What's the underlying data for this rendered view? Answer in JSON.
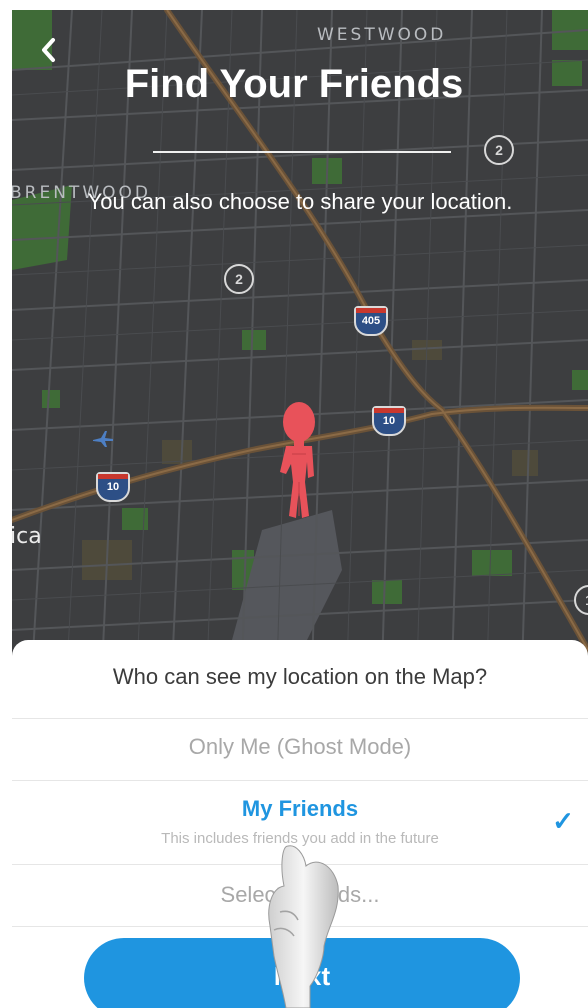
{
  "header": {
    "back_icon": "chevron-left-icon",
    "back_glyph": "‹",
    "title": "Find Your Friends",
    "subtitle": "You can also choose to share your location."
  },
  "map": {
    "labels": {
      "westwood": "WESTWOOD",
      "brentwood": "BRENTWOOD",
      "partial_city": "ica"
    },
    "route_badges": [
      "2",
      "2",
      "1"
    ],
    "interstates": [
      "405",
      "10",
      "10"
    ],
    "avatar_icon": "bitmoji-avatar-icon",
    "airport_icon": "airplane-icon",
    "colors": {
      "background": "#3d3e40",
      "roads": "#6a5238",
      "parks": "#3f6b37",
      "avatar": "#e8525a"
    }
  },
  "sheet": {
    "question": "Who can see my location on the Map?",
    "options": [
      {
        "label": "Only Me (Ghost Mode)",
        "sublabel": ""
      },
      {
        "label": "My Friends",
        "sublabel": "This includes friends you add in the future"
      },
      {
        "label": "Select Friends..."
      }
    ],
    "selected_index": 1,
    "check_glyph": "✓"
  },
  "next_button": {
    "label": "Next"
  },
  "colors": {
    "accent": "#1f95e0"
  }
}
